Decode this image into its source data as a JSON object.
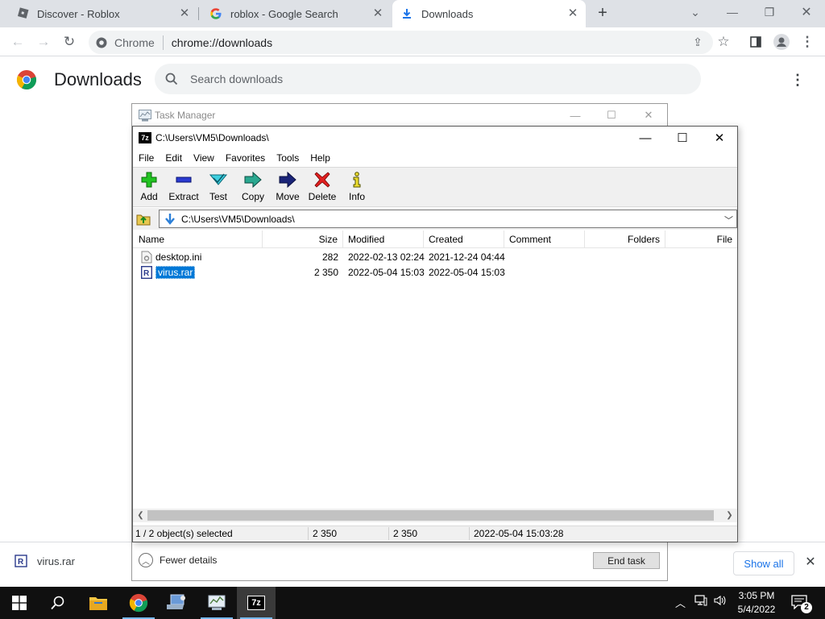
{
  "browser": {
    "tabs": [
      {
        "title": "Discover - Roblox",
        "icon": "roblox-icon",
        "active": false
      },
      {
        "title": "roblox - Google Search",
        "icon": "google-icon",
        "active": false
      },
      {
        "title": "Downloads",
        "icon": "download-icon",
        "active": true
      }
    ],
    "omnibox": {
      "chip": "Chrome",
      "url": "chrome://downloads"
    }
  },
  "downloads_page": {
    "title": "Downloads",
    "search_placeholder": "Search downloads"
  },
  "shelf": {
    "file": "virus.rar",
    "show_all": "Show all"
  },
  "task_manager": {
    "title": "Task Manager",
    "fewer_details": "Fewer details",
    "end_task": "End task"
  },
  "sevenzip": {
    "title": "C:\\Users\\VM5\\Downloads\\",
    "menu": [
      "File",
      "Edit",
      "View",
      "Favorites",
      "Tools",
      "Help"
    ],
    "toolbar": [
      "Add",
      "Extract",
      "Test",
      "Copy",
      "Move",
      "Delete",
      "Info"
    ],
    "address": "C:\\Users\\VM5\\Downloads\\",
    "columns": [
      "Name",
      "Size",
      "Modified",
      "Created",
      "Comment",
      "Folders",
      "File"
    ],
    "files": [
      {
        "name": "desktop.ini",
        "size": "282",
        "modified": "2022-02-13 02:24",
        "created": "2021-12-24 04:44",
        "selected": false
      },
      {
        "name": "virus.rar",
        "size": "2 350",
        "modified": "2022-05-04 15:03",
        "created": "2022-05-04 15:03",
        "selected": true
      }
    ],
    "status": {
      "selection": "1 / 2 object(s) selected",
      "size": "2 350",
      "packed": "2 350",
      "date": "2022-05-04 15:03:28"
    }
  },
  "taskbar": {
    "time": "3:05 PM",
    "date": "5/4/2022",
    "notifications": "2"
  }
}
